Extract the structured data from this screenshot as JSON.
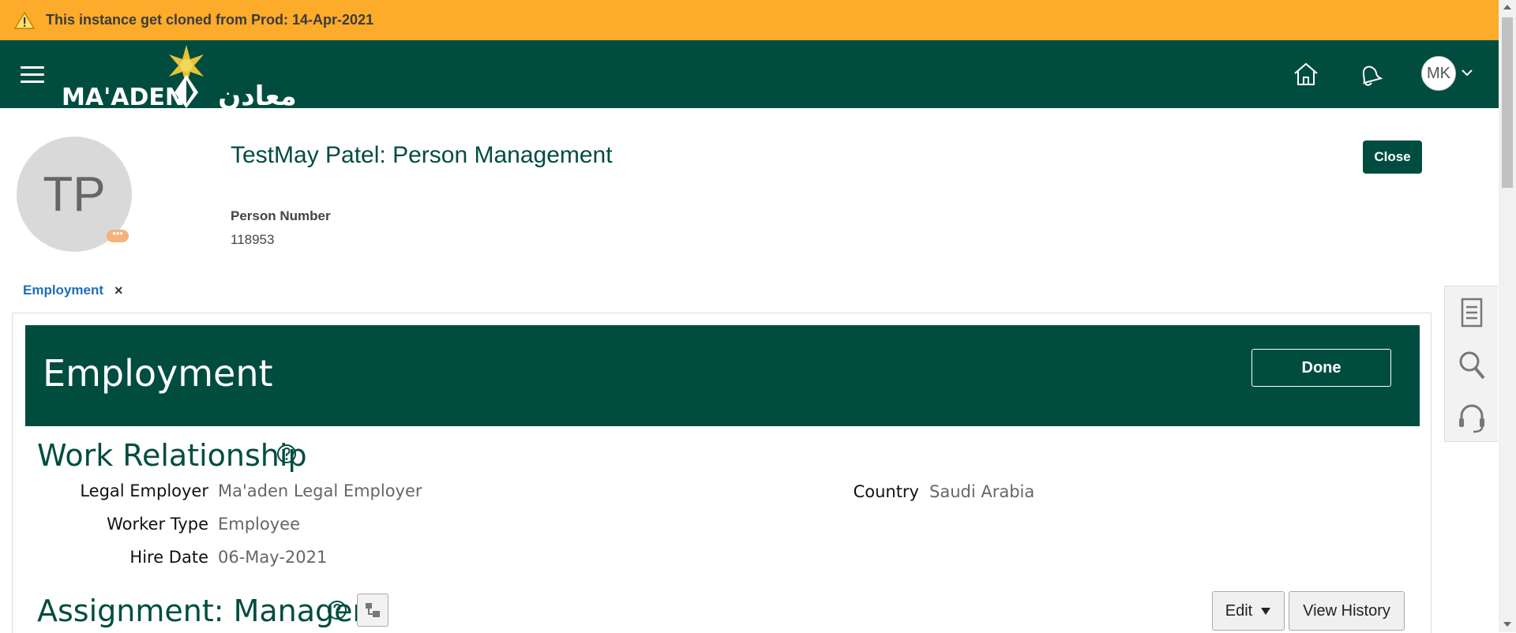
{
  "banner": {
    "text": "This instance get cloned from Prod: 14-Apr-2021",
    "color": "#fdab2a",
    "icon": "warning-icon"
  },
  "header": {
    "brand_color": "#004d40",
    "logo_text_latin": "MA'ADEN",
    "logo_text_arabic": "معادن",
    "user_initials": "MK",
    "icons": [
      "menu-icon",
      "home-icon",
      "notifications-bell-icon",
      "chevron-down-icon"
    ]
  },
  "person": {
    "initials": "TP",
    "title": "TestMay Patel: Person Management",
    "number_label": "Person Number",
    "number_value": "118953",
    "close_label": "Close"
  },
  "tabs": [
    {
      "label": "Employment",
      "active": true,
      "close_glyph": "×"
    }
  ],
  "employment": {
    "title": "Employment",
    "done_label": "Done"
  },
  "work_relationship": {
    "title": "Work Relationship",
    "legal_employer_label": "Legal Employer",
    "legal_employer_value": "Ma'aden Legal Employer",
    "worker_type_label": "Worker Type",
    "worker_type_value": "Employee",
    "hire_date_label": "Hire Date",
    "hire_date_value": "06-May-2021",
    "country_label": "Country",
    "country_value": "Saudi Arabia"
  },
  "assignment": {
    "title": "Assignment: Manager",
    "edit_label": "Edit",
    "view_history_label": "View History"
  },
  "side_panel": {
    "icons": [
      "document-icon",
      "search-icon",
      "headset-icon"
    ]
  }
}
